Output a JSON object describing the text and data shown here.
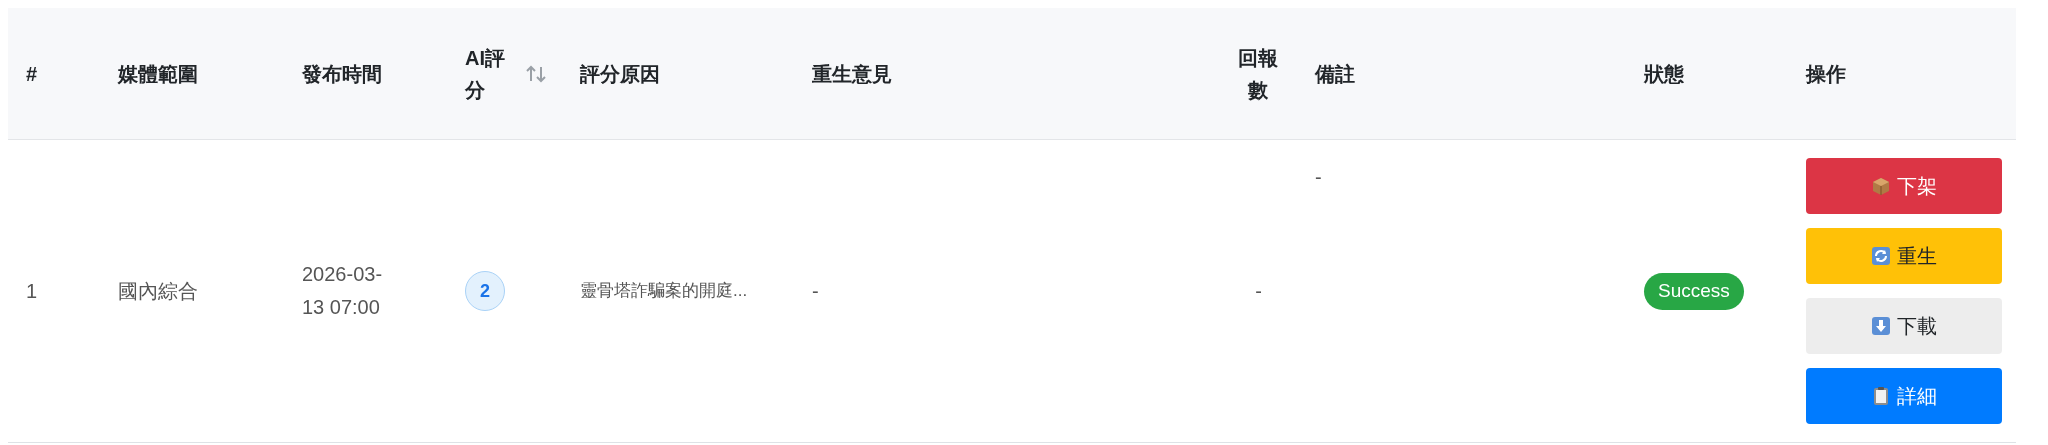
{
  "table": {
    "columns": [
      {
        "label": "#",
        "sortable": false
      },
      {
        "label": "媒體範圍",
        "sortable": false
      },
      {
        "label": "發布時間",
        "sortable": false
      },
      {
        "label": "AI評分",
        "sortable": true
      },
      {
        "label": "評分原因",
        "sortable": false
      },
      {
        "label": "重生意見",
        "sortable": false
      },
      {
        "label": "回報數",
        "sortable": false
      },
      {
        "label": "備註",
        "sortable": false
      },
      {
        "label": "狀態",
        "sortable": false
      },
      {
        "label": "操作",
        "sortable": false
      }
    ],
    "rows": [
      {
        "index": "1",
        "media": "國內綜合",
        "published": "2026-03-13 07:00",
        "score": "2",
        "reason": "靈骨塔詐騙案的開庭...",
        "rebirth_opinion": "-",
        "reports": "-",
        "note": "-",
        "status": {
          "label": "Success",
          "kind": "success"
        },
        "actions": [
          {
            "label": "下架",
            "kind": "danger"
          },
          {
            "label": "重生",
            "kind": "warning"
          },
          {
            "label": "下載",
            "kind": "light"
          },
          {
            "label": "詳細",
            "kind": "primary"
          }
        ]
      }
    ]
  }
}
